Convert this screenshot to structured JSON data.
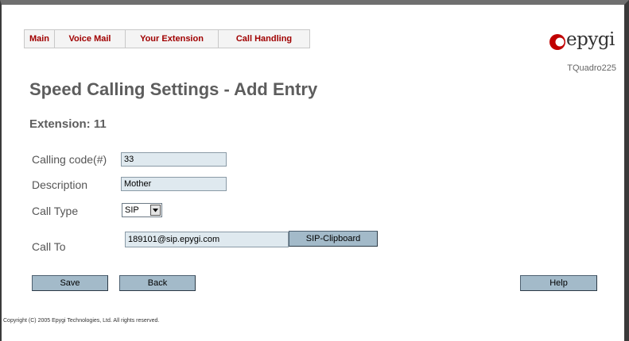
{
  "nav": {
    "tabs": [
      {
        "label": "Main"
      },
      {
        "label": "Voice Mail"
      },
      {
        "label": "Your Extension"
      },
      {
        "label": "Call Handling"
      }
    ]
  },
  "brand": {
    "logo_text": "epygi",
    "model": "TQuadro225",
    "accent_color": "#c00000"
  },
  "page": {
    "title": "Speed Calling Settings - Add Entry",
    "extension_label": "Extension: 11"
  },
  "form": {
    "calling_code": {
      "label": "Calling code(#)",
      "value": "33"
    },
    "description": {
      "label": "Description",
      "value": "Mother"
    },
    "call_type": {
      "label": "Call Type",
      "value": "SIP"
    },
    "call_to": {
      "label": "Call To",
      "value": "189101@sip.epygi.com",
      "clipboard_button": "SIP-Clipboard"
    }
  },
  "buttons": {
    "save": "Save",
    "back": "Back",
    "help": "Help"
  },
  "footer": {
    "copyright": "Copyright (C) 2005 Epygi Technologies, Ltd. All rights reserved."
  },
  "colors": {
    "tab_text": "#a00000",
    "heading": "#5d5d5d",
    "button_bg": "#a3bac9",
    "field_bg": "#dfe9ef"
  }
}
